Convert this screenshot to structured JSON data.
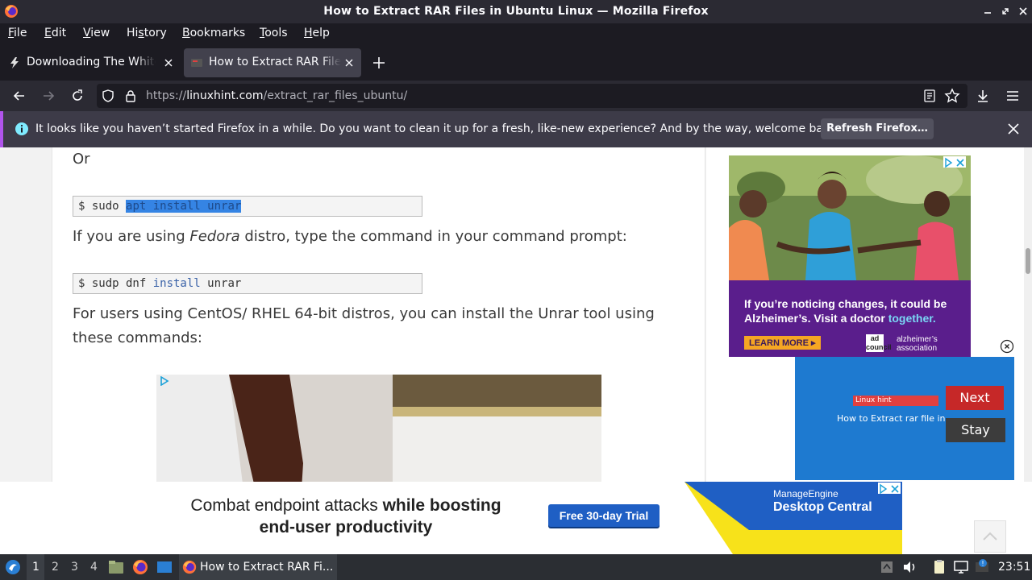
{
  "window": {
    "title": "How to Extract RAR Files in Ubuntu Linux — Mozilla Firefox"
  },
  "menu": [
    "File",
    "Edit",
    "View",
    "History",
    "Bookmarks",
    "Tools",
    "Help"
  ],
  "menu_accels": [
    "F",
    "E",
    "V",
    "s",
    "B",
    "T",
    "H"
  ],
  "tabs": [
    {
      "label": "Downloading The White House",
      "active": false
    },
    {
      "label": "How to Extract RAR Files in Ubuntu",
      "active": true
    }
  ],
  "urlbar": {
    "scheme": "https://",
    "domain": "linuxhint.com",
    "path": "/extract_rar_files_ubuntu/"
  },
  "notification": {
    "message": "It looks like you haven’t started Firefox in a while. Do you want to clean it up for a fresh, like-new experience? And by the way, welcome back!",
    "button": "Refresh Firefox…"
  },
  "article": {
    "or_text": "Or",
    "code1_prompt": "$ sudo ",
    "code1_selected": "apt install unrar",
    "para1_pre": "If you are using ",
    "para1_em": "Fedora",
    "para1_post": " distro, type the command in your command prompt:",
    "code2_prompt": "$ sudp dnf ",
    "code2_kw": "install",
    "code2_rest": " unrar",
    "para2": "For users using CentOS/ RHEL 64-bit distros, you can install the Unrar tool using these commands:"
  },
  "ad_alz": {
    "text_pre": "If you’re noticing changes, it could be Alzheimer’s. Visit a doctor ",
    "text_accent": "together.",
    "cta": "LEARN MORE ▸",
    "logo": "ad council",
    "partner": "alzheimer’s association"
  },
  "video_ad": {
    "site_label": "Linux hint",
    "video_title": "How to Extract rar file in ...",
    "next": "Next",
    "stay": "Stay"
  },
  "banner": {
    "line1_normal": "Combat endpoint attacks ",
    "line1_bold": "while boosting",
    "line2": "end-user productivity",
    "cta": "Free 30-day Trial",
    "brand_small": "ManageEngine",
    "brand_product": "Desktop Central"
  },
  "taskbar": {
    "workspaces": [
      "1",
      "2",
      "3",
      "4"
    ],
    "active_workspace": "1",
    "task_label": "How to Extract RAR Fi...",
    "clock": "23:51"
  },
  "colors": {
    "notification_accent": "#b054ec",
    "code_selection": "#3584e4",
    "next_button": "#c62828",
    "trial_button": "#1f5fc4"
  }
}
